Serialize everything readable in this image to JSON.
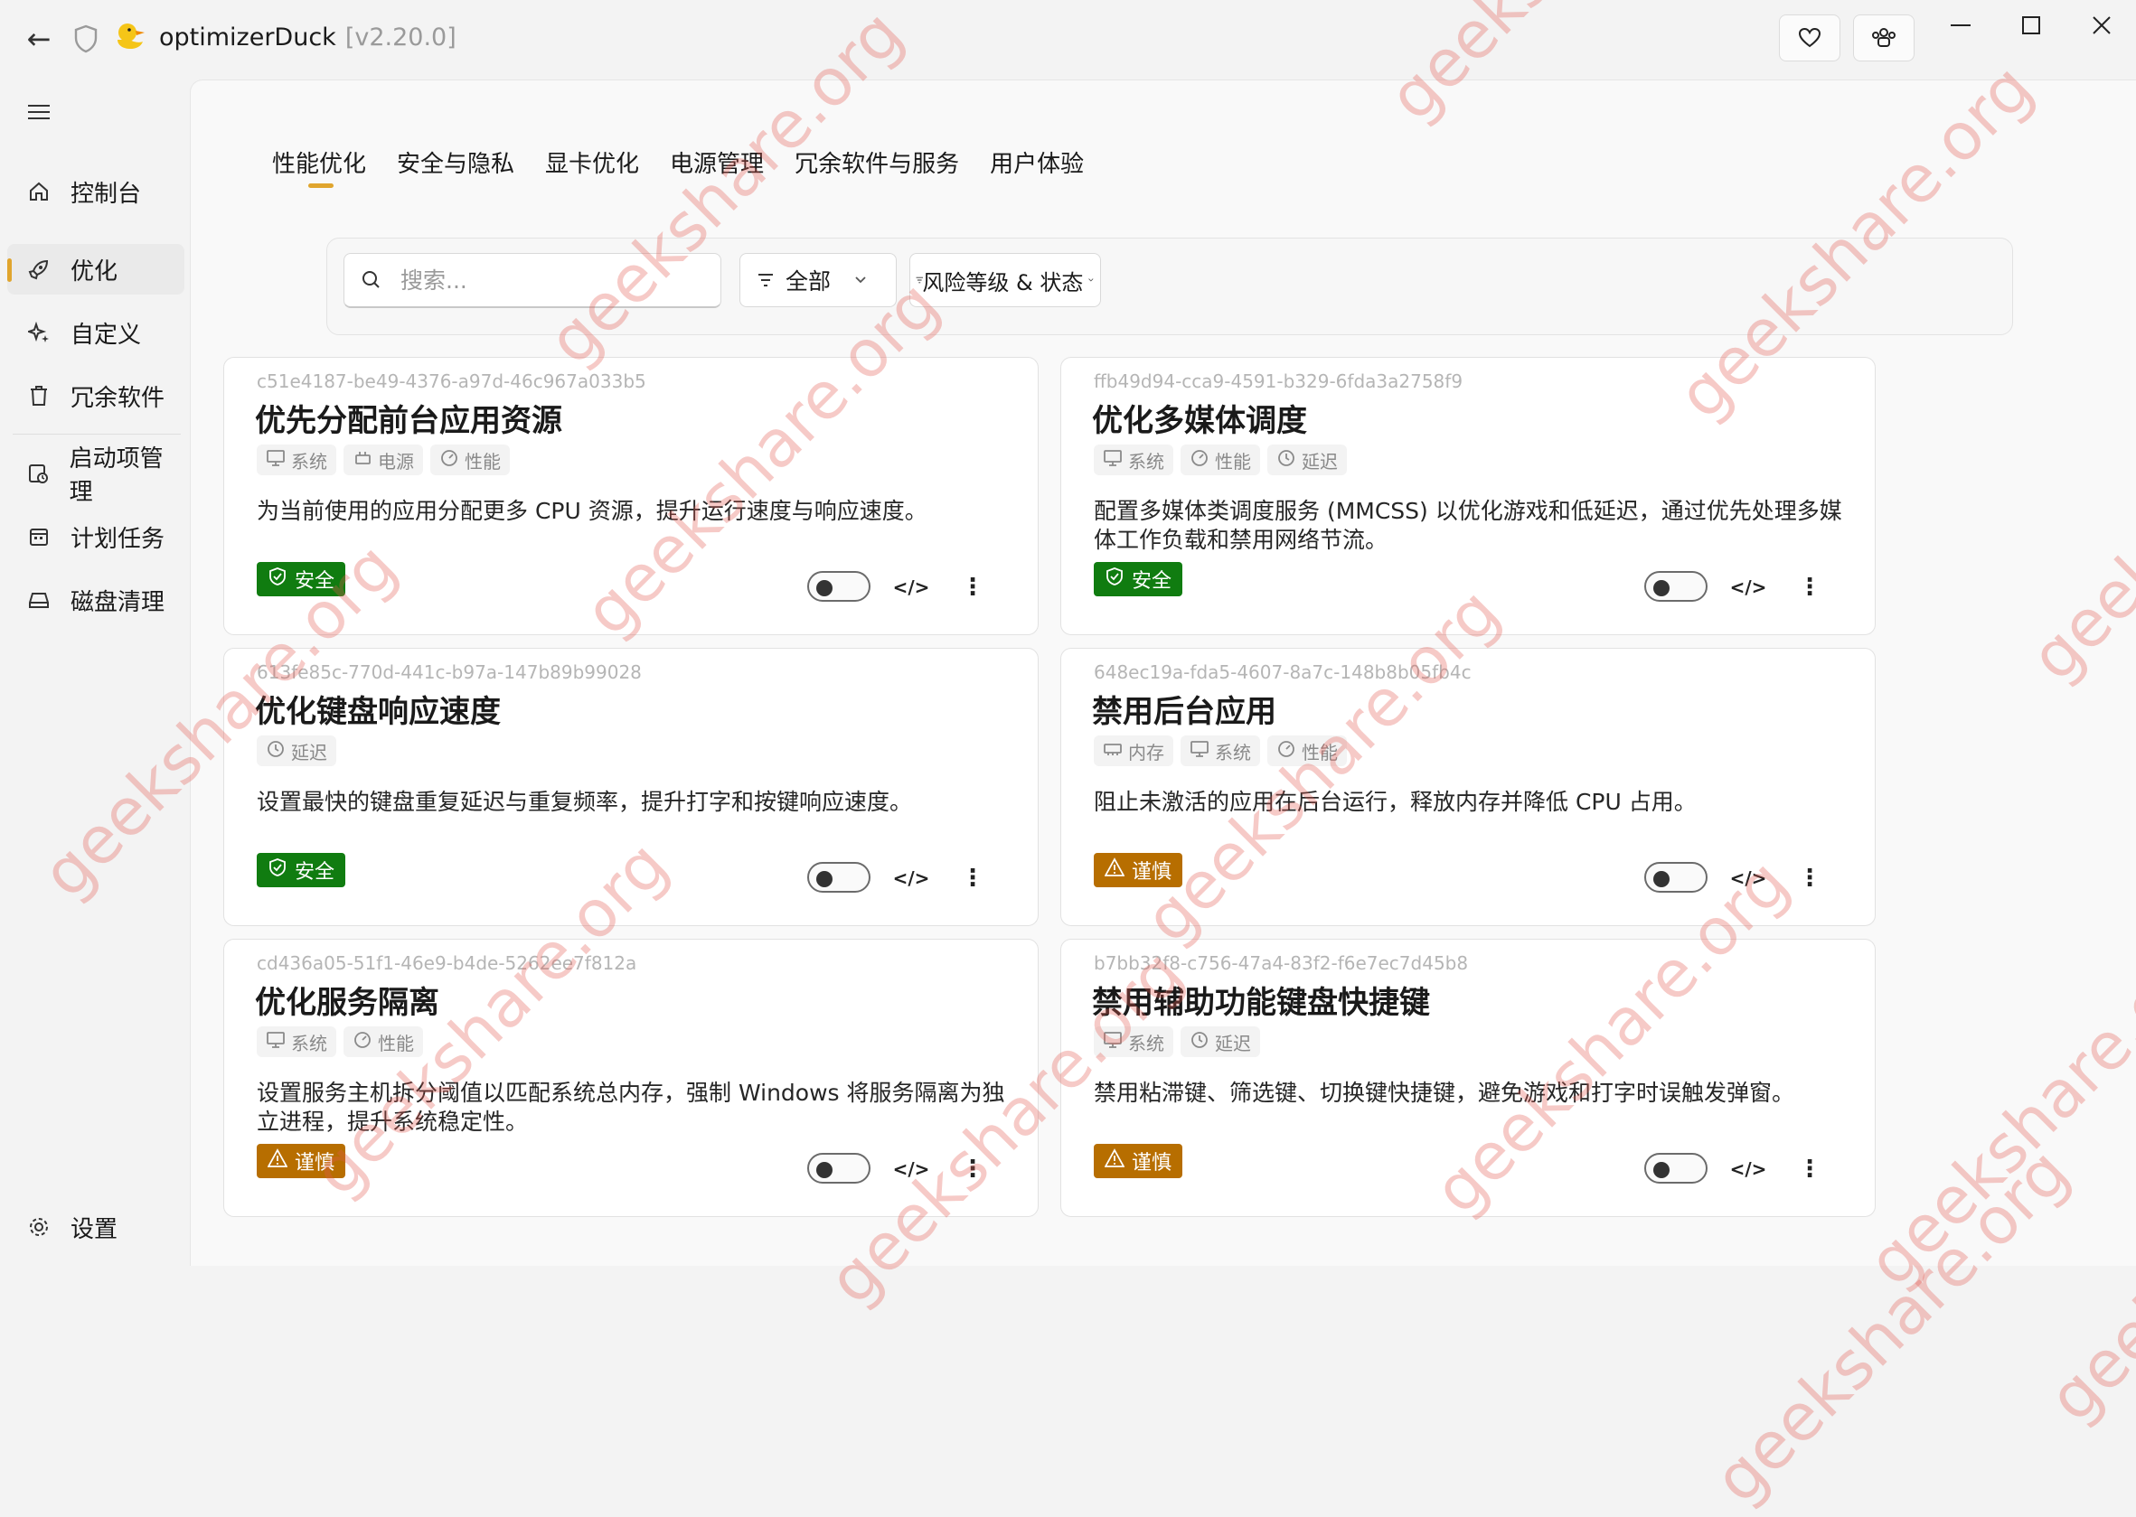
{
  "app": {
    "title": "optimizerDuck",
    "version": "[v2.20.0]"
  },
  "sidebar": {
    "items": [
      {
        "label": "控制台",
        "icon": "home-icon"
      },
      {
        "label": "优化",
        "icon": "rocket-icon"
      },
      {
        "label": "自定义",
        "icon": "sparkle-icon"
      },
      {
        "label": "冗余软件",
        "icon": "trash-icon"
      },
      {
        "label": "启动项管理",
        "icon": "startup-icon"
      },
      {
        "label": "计划任务",
        "icon": "calendar-icon"
      },
      {
        "label": "磁盘清理",
        "icon": "disk-icon"
      }
    ],
    "settings_label": "设置"
  },
  "tabs": [
    "性能优化",
    "安全与隐私",
    "显卡优化",
    "电源管理",
    "冗余软件与服务",
    "用户体验"
  ],
  "filters": {
    "search_placeholder": "搜索...",
    "category": "全部",
    "risk_status": "风险等级 & 状态"
  },
  "colors": {
    "accent": "#e0a52e",
    "safe": "#107c10",
    "warn": "#b76e00"
  },
  "cards": [
    {
      "id": "c51e4187-be49-4376-a97d-46c967a033b5",
      "title": "优先分配前台应用资源",
      "tags": [
        {
          "label": "系统",
          "icon": "monitor-icon"
        },
        {
          "label": "电源",
          "icon": "power-icon"
        },
        {
          "label": "性能",
          "icon": "gauge-icon"
        }
      ],
      "desc": "为当前使用的应用分配更多 CPU 资源，提升运行速度与响应速度。",
      "badge": "安全",
      "badge_type": "safe",
      "enabled": false
    },
    {
      "id": "ffb49d94-cca9-4591-b329-6fda3a2758f9",
      "title": "优化多媒体调度",
      "tags": [
        {
          "label": "系统",
          "icon": "monitor-icon"
        },
        {
          "label": "性能",
          "icon": "gauge-icon"
        },
        {
          "label": "延迟",
          "icon": "clock-icon"
        }
      ],
      "desc": "配置多媒体类调度服务 (MMCSS) 以优化游戏和低延迟，通过优先处理多媒体工作负载和禁用网络节流。",
      "badge": "安全",
      "badge_type": "safe",
      "enabled": false
    },
    {
      "id": "613fe85c-770d-441c-b97a-147b89b99028",
      "title": "优化键盘响应速度",
      "tags": [
        {
          "label": "延迟",
          "icon": "clock-icon"
        }
      ],
      "desc": "设置最快的键盘重复延迟与重复频率，提升打字和按键响应速度。",
      "badge": "安全",
      "badge_type": "safe",
      "enabled": false
    },
    {
      "id": "648ec19a-fda5-4607-8a7c-148b8b05fb4c",
      "title": "禁用后台应用",
      "tags": [
        {
          "label": "内存",
          "icon": "memory-icon"
        },
        {
          "label": "系统",
          "icon": "monitor-icon"
        },
        {
          "label": "性能",
          "icon": "gauge-icon"
        }
      ],
      "desc": "阻止未激活的应用在后台运行，释放内存并降低 CPU 占用。",
      "badge": "谨慎",
      "badge_type": "warn",
      "enabled": false
    },
    {
      "id": "cd436a05-51f1-46e9-b4de-5262ee7f812a",
      "title": "优化服务隔离",
      "tags": [
        {
          "label": "系统",
          "icon": "monitor-icon"
        },
        {
          "label": "性能",
          "icon": "gauge-icon"
        }
      ],
      "desc": "设置服务主机拆分阈值以匹配系统总内存，强制 Windows 将服务隔离为独立进程，提升系统稳定性。",
      "badge": "谨慎",
      "badge_type": "warn",
      "enabled": false
    },
    {
      "id": "b7bb32f8-c756-47a4-83f2-f6e7ec7d45b8",
      "title": "禁用辅助功能键盘快捷键",
      "tags": [
        {
          "label": "系统",
          "icon": "monitor-icon"
        },
        {
          "label": "延迟",
          "icon": "clock-icon"
        }
      ],
      "desc": "禁用粘滞键、筛选键、切换键快捷键，避免游戏和打字时误触发弹窗。",
      "badge": "谨慎",
      "badge_type": "warn",
      "enabled": false
    }
  ],
  "watermark": "geekshare.org"
}
